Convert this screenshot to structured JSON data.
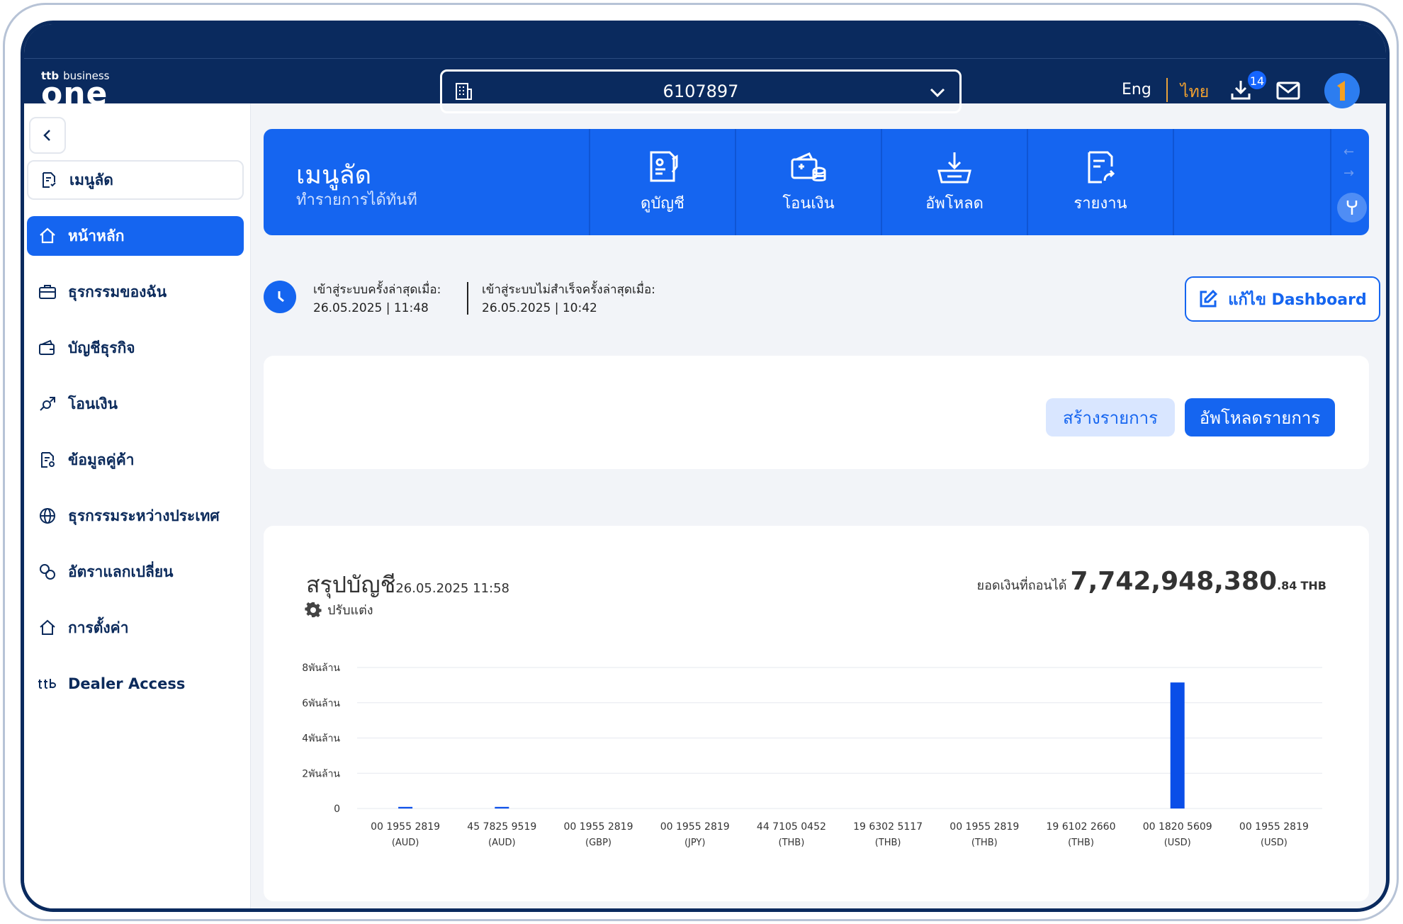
{
  "header": {
    "logo_small": "business",
    "logo_brand": "ttb",
    "logo_big": "one",
    "account_number": "6107897",
    "lang_en": "Eng",
    "lang_th": "ไทย",
    "download_badge": "14"
  },
  "sidebar": {
    "items": [
      {
        "label": "เมนูลัด",
        "icon": "quick-menu-icon"
      },
      {
        "label": "หน้าหลัก",
        "icon": "home-icon"
      },
      {
        "label": "ธุรกรรมของฉัน",
        "icon": "briefcase-icon"
      },
      {
        "label": "บัญชีธุรกิจ",
        "icon": "wallet-icon"
      },
      {
        "label": "โอนเงิน",
        "icon": "transfer-icon"
      },
      {
        "label": "ข้อมูลคู่ค้า",
        "icon": "partner-icon"
      },
      {
        "label": "ธุรกรรมระหว่างประเทศ",
        "icon": "globe-icon"
      },
      {
        "label": "อัตราแลกเปลี่ยน",
        "icon": "exchange-icon"
      },
      {
        "label": "การตั้งค่า",
        "icon": "settings-home-icon"
      },
      {
        "label": "Dealer Access",
        "icon": "ttb-icon"
      }
    ]
  },
  "quick_menu": {
    "title": "เมนูลัด",
    "subtitle": "ทำรายการได้ทันที",
    "items": [
      {
        "label": "ดูบัญชี",
        "icon": "view-account-icon"
      },
      {
        "label": "โอนเงิน",
        "icon": "wallet-transfer-icon"
      },
      {
        "label": "อัพโหลด",
        "icon": "upload-icon"
      },
      {
        "label": "รายงาน",
        "icon": "report-icon"
      }
    ]
  },
  "login": {
    "last_login_label": "เข้าสู่ระบบครั้งล่าสุดเมื่อ:",
    "last_login_value": "26.05.2025 | 11:48",
    "last_failed_label": "เข้าสู่ระบบไม่สำเร็จครั้งล่าสุดเมื่อ:",
    "last_failed_value": "26.05.2025 | 10:42",
    "edit_dashboard": "แก้ไข Dashboard"
  },
  "actions": {
    "create": "สร้างรายการ",
    "upload": "อัพโหลดรายการ"
  },
  "summary": {
    "title": "สรุปบัญชี",
    "date": "26.05.2025 11:58",
    "settings": "ปรับแต่ง",
    "balance_label": "ยอดเงินที่ถอนได้",
    "balance_int": "7,742,948,380",
    "balance_dec": ".84",
    "balance_cur": "THB"
  },
  "chart_data": {
    "type": "bar",
    "categories": [
      [
        "00 1955 2819",
        "(AUD)"
      ],
      [
        "45 7825 9519",
        "(AUD)"
      ],
      [
        "00 1955 2819",
        "(GBP)"
      ],
      [
        "00 1955 2819",
        "(JPY)"
      ],
      [
        "44 7105 0452",
        "(THB)"
      ],
      [
        "19 6302 5117",
        "(THB)"
      ],
      [
        "00 1955 2819",
        "(THB)"
      ],
      [
        "19 6102 2660",
        "(THB)"
      ],
      [
        "00 1820 5609",
        "(USD)"
      ],
      [
        "00 1955 2819",
        "(USD)"
      ]
    ],
    "values": [
      0.09,
      0.09,
      0,
      0,
      0,
      0,
      0,
      0,
      7.15,
      0
    ],
    "y_ticks": [
      0,
      2,
      4,
      6,
      8
    ],
    "y_tick_labels": [
      "0",
      "2พันล้าน",
      "4พันล้าน",
      "6พันล้าน",
      "8พันล้าน"
    ],
    "ylim": [
      0,
      8
    ],
    "bar_color": "#0a4ee8",
    "grid": true
  },
  "colors": {
    "navy": "#0a2a5e",
    "primary": "#1565f0",
    "accent": "#f0a030"
  }
}
